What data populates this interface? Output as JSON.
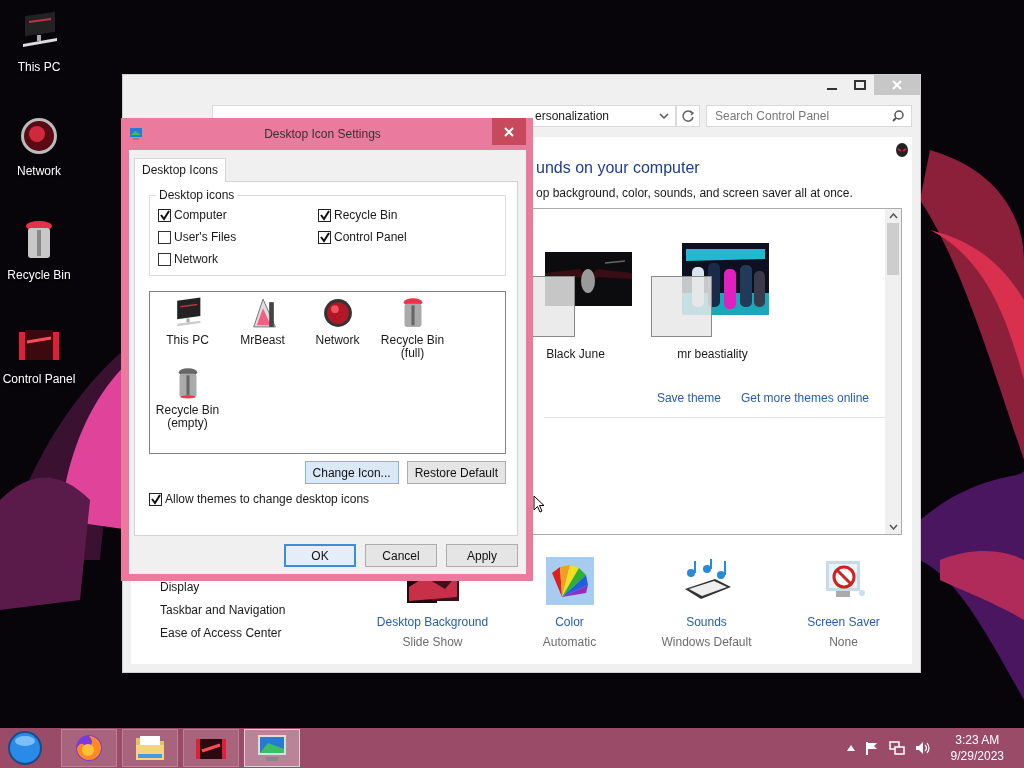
{
  "desktop_icons": [
    {
      "label": "This PC",
      "kind": "pc"
    },
    {
      "label": "Network",
      "kind": "network"
    },
    {
      "label": "Recycle Bin",
      "kind": "bin"
    },
    {
      "label": "Control Panel",
      "kind": "panel"
    }
  ],
  "personalization_window": {
    "address": "ersonalization",
    "search": {
      "placeholder": "Search Control Panel"
    },
    "heading": "unds on your computer",
    "description": "op background, color, sounds, and screen saver all at once.",
    "themes": [
      {
        "name": "Black June"
      },
      {
        "name": "mr beastiality"
      }
    ],
    "links": [
      "Save theme",
      "Get more themes online"
    ],
    "see_also": [
      "Display",
      "Taskbar and Navigation",
      "Ease of Access Center"
    ],
    "settings": [
      {
        "label": "Desktop Background",
        "value": "Slide Show",
        "kind": "background"
      },
      {
        "label": "Color",
        "value": "Automatic",
        "kind": "color"
      },
      {
        "label": "Sounds",
        "value": "Windows Default",
        "kind": "sounds"
      },
      {
        "label": "Screen Saver",
        "value": "None",
        "kind": "screensaver"
      }
    ]
  },
  "dialog": {
    "title": "Desktop Icon Settings",
    "tabs": [
      {
        "label": "Desktop Icons",
        "selected": true
      }
    ],
    "group_label": "Desktop icons",
    "checkboxes": [
      {
        "label": "Computer",
        "checked": true
      },
      {
        "label": "Recycle Bin",
        "checked": true
      },
      {
        "label": "User's Files",
        "checked": false
      },
      {
        "label": "Control Panel",
        "checked": true
      },
      {
        "label": "Network",
        "checked": false
      }
    ],
    "icons": [
      {
        "label": "This PC",
        "kind": "pc"
      },
      {
        "label": "MrBeast",
        "kind": "user"
      },
      {
        "label": "Network",
        "kind": "network"
      },
      {
        "label": "Recycle Bin (full)",
        "kind": "bin_full"
      },
      {
        "label": "Recycle Bin (empty)",
        "kind": "bin_empty"
      }
    ],
    "icon_buttons": [
      {
        "label": "Change Icon...",
        "highlighted": true
      },
      {
        "label": "Restore Default",
        "highlighted": false
      }
    ],
    "allow_themes": {
      "label": "Allow themes to change desktop icons",
      "checked": true
    },
    "buttons": [
      {
        "label": "OK",
        "default": true
      },
      {
        "label": "Cancel",
        "default": false
      },
      {
        "label": "Apply",
        "default": false
      }
    ]
  },
  "taskbar": {
    "apps": [
      {
        "kind": "firefox",
        "selected": false
      },
      {
        "kind": "explorer",
        "selected": false
      },
      {
        "kind": "game",
        "selected": false
      },
      {
        "kind": "personalization",
        "selected": true
      }
    ],
    "time": "3:23 AM",
    "date": "9/29/2023"
  }
}
